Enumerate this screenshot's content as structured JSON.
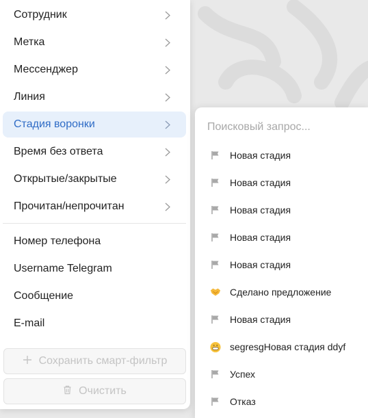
{
  "colors": {
    "accent": "#2f6cc6",
    "active_bg": "#e7f0fb",
    "text": "#222222",
    "muted": "#a8a8a8",
    "flag": "#a9a9a9"
  },
  "menu": {
    "items": [
      {
        "label": "Сотрудник",
        "has_submenu": true
      },
      {
        "label": "Метка",
        "has_submenu": true
      },
      {
        "label": "Мессенджер",
        "has_submenu": true
      },
      {
        "label": "Линия",
        "has_submenu": true
      },
      {
        "label": "Стадия воронки",
        "has_submenu": true,
        "active": true
      },
      {
        "label": "Время без ответа",
        "has_submenu": true
      },
      {
        "label": "Открытые/закрытые",
        "has_submenu": true
      },
      {
        "label": "Прочитан/непрочитан",
        "has_submenu": true
      },
      {
        "label": "Номер телефона",
        "has_submenu": false
      },
      {
        "label": "Username Telegram",
        "has_submenu": false
      },
      {
        "label": "Сообщение",
        "has_submenu": false
      },
      {
        "label": "E-mail",
        "has_submenu": false
      }
    ],
    "save_label": "Сохранить смарт-фильтр",
    "save_icon": "plus-icon",
    "clear_label": "Очистить",
    "clear_icon": "trash-icon"
  },
  "submenu": {
    "search_placeholder": "Поисковый запрос...",
    "items": [
      {
        "label": "Новая стадия",
        "icon": "flag-icon"
      },
      {
        "label": "Новая стадия",
        "icon": "flag-icon"
      },
      {
        "label": "Новая стадия",
        "icon": "flag-icon"
      },
      {
        "label": "Новая стадия",
        "icon": "flag-icon"
      },
      {
        "label": "Новая стадия",
        "icon": "flag-icon"
      },
      {
        "label": "Сделано предложение",
        "icon": "handshake-emoji-icon"
      },
      {
        "label": "Новая стадия",
        "icon": "flag-icon"
      },
      {
        "label": "segresgНовая стадия ddyf",
        "icon": "grin-emoji-icon"
      },
      {
        "label": "Успех",
        "icon": "flag-icon"
      },
      {
        "label": "Отказ",
        "icon": "flag-icon"
      }
    ]
  }
}
